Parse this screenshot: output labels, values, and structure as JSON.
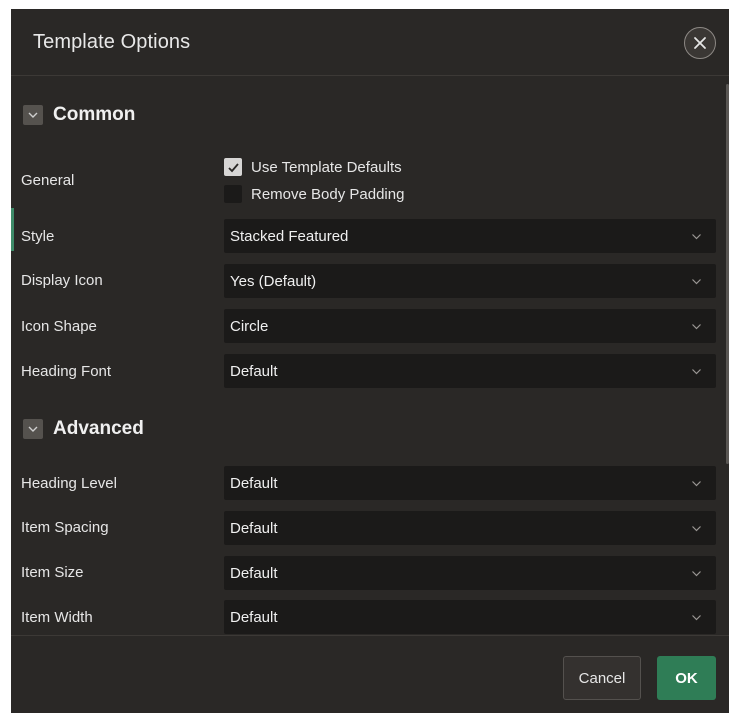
{
  "dialog": {
    "title": "Template Options"
  },
  "sections": {
    "common": "Common",
    "advanced": "Advanced"
  },
  "general": {
    "label": "General",
    "use_defaults": {
      "label": "Use Template Defaults",
      "checked": true
    },
    "remove_padding": {
      "label": "Remove Body Padding",
      "checked": false
    }
  },
  "fields": {
    "style": {
      "label": "Style",
      "value": "Stacked Featured"
    },
    "display_icon": {
      "label": "Display Icon",
      "value": "Yes (Default)"
    },
    "icon_shape": {
      "label": "Icon Shape",
      "value": "Circle"
    },
    "heading_font": {
      "label": "Heading Font",
      "value": "Default"
    },
    "heading_level": {
      "label": "Heading Level",
      "value": "Default"
    },
    "item_spacing": {
      "label": "Item Spacing",
      "value": "Default"
    },
    "item_size": {
      "label": "Item Size",
      "value": "Default"
    },
    "item_width": {
      "label": "Item Width",
      "value": "Default"
    }
  },
  "footer": {
    "cancel": "Cancel",
    "ok": "OK"
  },
  "colors": {
    "dialog_bg": "#2a2826",
    "field_bg": "#1b1a19",
    "accent": "#3d8a68",
    "ok_button": "#2f7d56"
  },
  "icons": {
    "close": "close-icon",
    "section_toggle": "chevron-down-icon",
    "select_arrow": "chevron-down-icon",
    "check": "check-icon"
  }
}
